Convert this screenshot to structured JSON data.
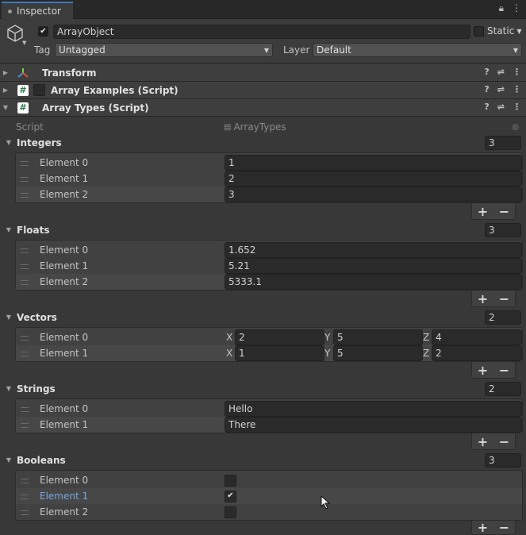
{
  "window": {
    "tab_label": "Inspector"
  },
  "header": {
    "object_name": "ArrayObject",
    "active": true,
    "static_label": "Static",
    "tag_label": "Tag",
    "tag_value": "Untagged",
    "layer_label": "Layer",
    "layer_value": "Default"
  },
  "components": [
    {
      "name": "Transform",
      "expanded": false
    },
    {
      "name": "Array Examples (Script)",
      "expanded": false,
      "enabled": false
    },
    {
      "name": "Array Types (Script)",
      "expanded": true
    }
  ],
  "script_field": {
    "label": "Script",
    "value": "ArrayTypes"
  },
  "lists": {
    "integers": {
      "label": "Integers",
      "count": "3",
      "elements": [
        "Element 0",
        "Element 1",
        "Element 2"
      ],
      "values": [
        "1",
        "2",
        "3"
      ]
    },
    "floats": {
      "label": "Floats",
      "count": "3",
      "elements": [
        "Element 0",
        "Element 1",
        "Element 2"
      ],
      "values": [
        "1.652",
        "5.21",
        "5333.1"
      ]
    },
    "vectors": {
      "label": "Vectors",
      "count": "2",
      "elements": [
        "Element 0",
        "Element 1"
      ],
      "values": [
        {
          "x": "2",
          "y": "5",
          "z": "4"
        },
        {
          "x": "1",
          "y": "5",
          "z": "2"
        }
      ]
    },
    "strings": {
      "label": "Strings",
      "count": "2",
      "elements": [
        "Element 0",
        "Element 1"
      ],
      "values": [
        "Hello",
        "There"
      ]
    },
    "booleans": {
      "label": "Booleans",
      "count": "3",
      "elements": [
        "Element 0",
        "Element 1",
        "Element 2"
      ],
      "values": [
        false,
        true,
        false
      ]
    }
  },
  "axis_labels": {
    "x": "X",
    "y": "Y",
    "z": "Z"
  },
  "list_buttons": {
    "add": "+",
    "remove": "−"
  }
}
